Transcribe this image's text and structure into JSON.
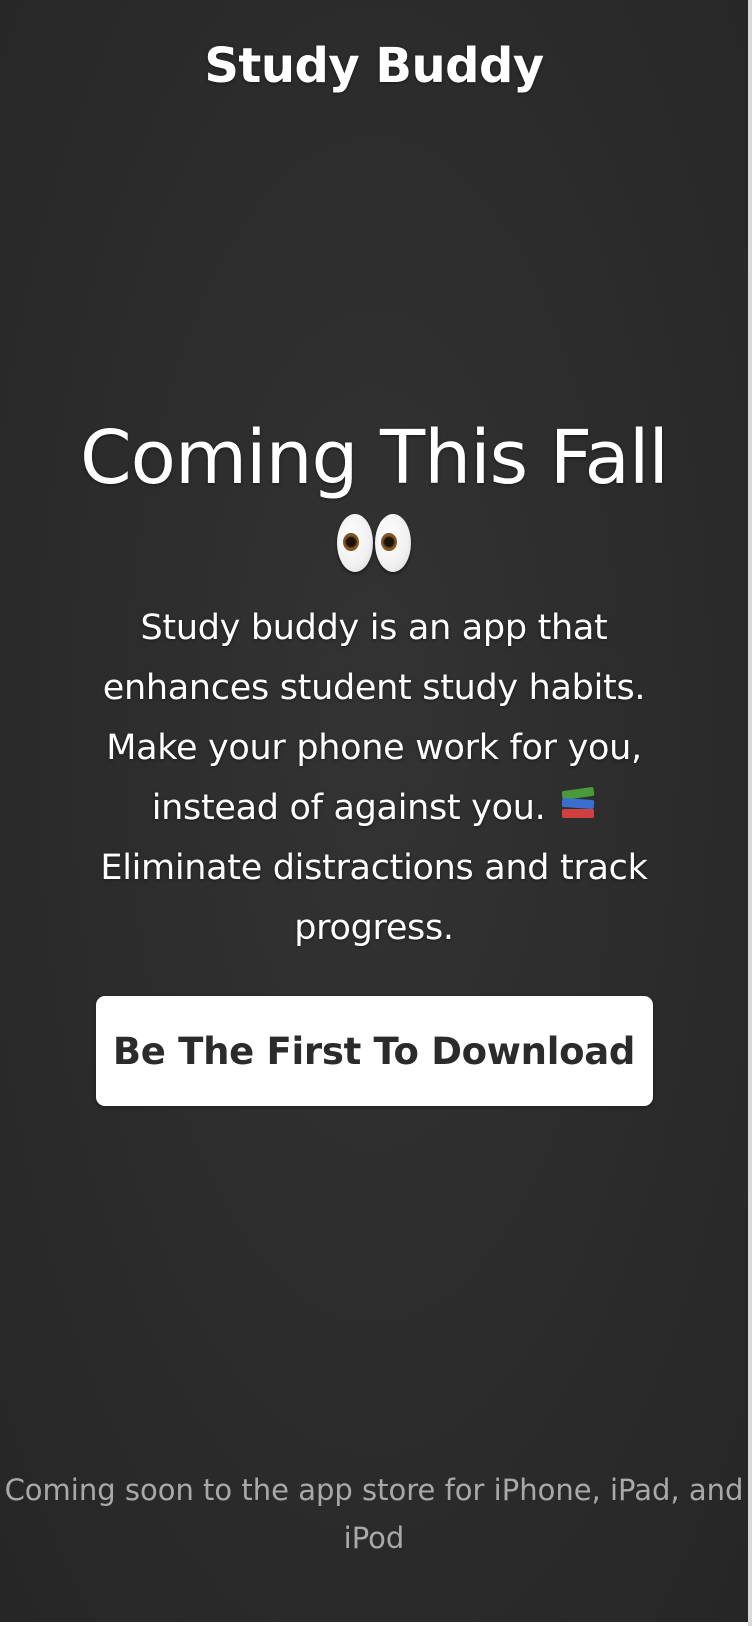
{
  "header": {
    "brand": "Study Buddy"
  },
  "hero": {
    "headline": "Coming This Fall",
    "headline_emoji": "eyes",
    "description_main": "Study buddy is an app that enhances student study habits. Make your phone work for you, instead of against you.",
    "description_emoji": "books",
    "description_tail": "Eliminate distractions and track progress.",
    "cta_label": "Be The First To Download"
  },
  "footer": {
    "note": "Coming soon to the app store for iPhone, iPad, and iPod"
  },
  "colors": {
    "background": "#2d2d2d",
    "text": "#ffffff",
    "muted_text": "#a9a9a9",
    "button_bg": "#ffffff",
    "button_text": "#2b2b2b"
  }
}
